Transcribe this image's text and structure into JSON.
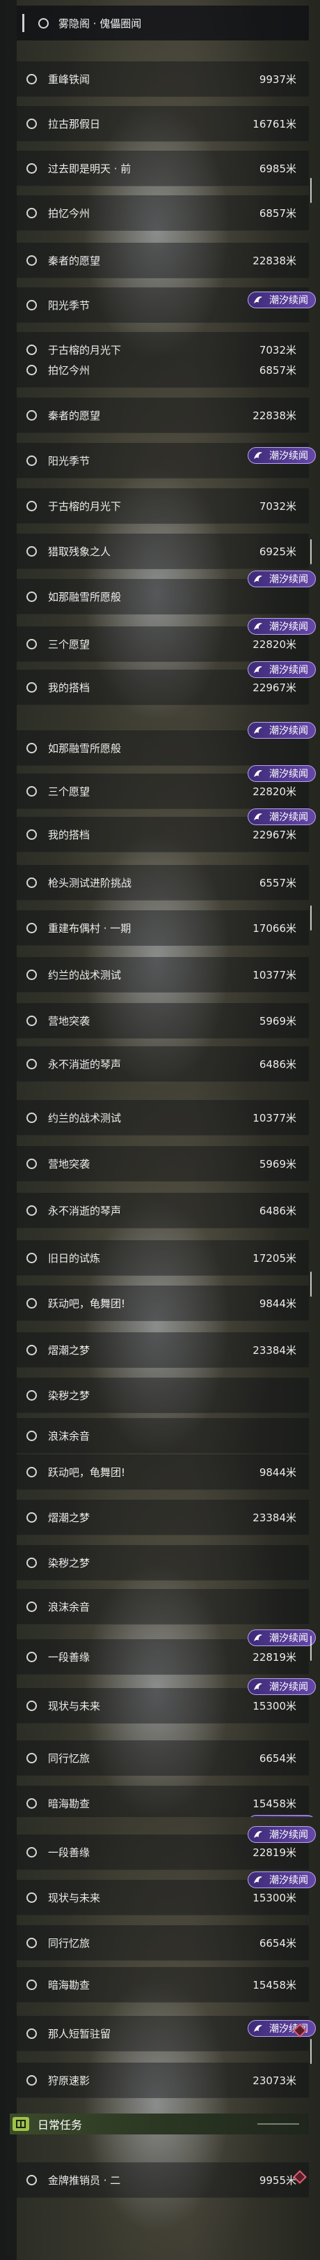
{
  "badge_label": "潮汐续闻",
  "header_title": "雾隐阁 · 傀儡圈闻",
  "daily_title": "日常任务",
  "colors": {
    "badge": "#5a3c9c",
    "accent_green": "#9ec24a",
    "alert": "#e06070"
  },
  "panels": [
    {
      "rows": [
        {
          "name": "重峰铁闻",
          "dist": "9937米"
        },
        {
          "name": "拉古那假日",
          "dist": "16761米"
        },
        {
          "name": "过去即是明天 · 前",
          "dist": "6985米"
        },
        {
          "name": "拍忆今州",
          "dist": "6857米"
        },
        {
          "name": "秦者的愿望",
          "dist": "22838米"
        },
        {
          "name": "阳光季节",
          "dist": ""
        },
        {
          "name": "于古榕的月光下",
          "dist": "7032米"
        }
      ]
    },
    {
      "rows": [
        {
          "name": "拍忆今州",
          "dist": "6857米"
        },
        {
          "name": "秦者的愿望",
          "dist": "22838米"
        },
        {
          "name": "阳光季节",
          "dist": ""
        },
        {
          "name": "于古榕的月光下",
          "dist": "7032米"
        },
        {
          "name": "猎取残象之人",
          "dist": "6925米"
        },
        {
          "name": "如那融雪所愿般",
          "dist": ""
        },
        {
          "name": "三个愿望",
          "dist": "22820米"
        },
        {
          "name": "我的搭档",
          "dist": "22967米"
        }
      ]
    },
    {
      "rows": [
        {
          "name": "如那融雪所愿般",
          "dist": ""
        },
        {
          "name": "三个愿望",
          "dist": "22820米"
        },
        {
          "name": "我的搭档",
          "dist": "22967米"
        },
        {
          "name": "枪头测试进阶挑战",
          "dist": "6557米"
        },
        {
          "name": "重建布偶村 · 一期",
          "dist": "17066米"
        },
        {
          "name": "约兰的战术测试",
          "dist": "10377米"
        },
        {
          "name": "营地突袭",
          "dist": "5969米"
        },
        {
          "name": "永不消逝的琴声",
          "dist": "6486米"
        }
      ]
    },
    {
      "rows": [
        {
          "name": "约兰的战术测试",
          "dist": "10377米"
        },
        {
          "name": "营地突袭",
          "dist": "5969米"
        },
        {
          "name": "永不消逝的琴声",
          "dist": "6486米"
        },
        {
          "name": "旧日的试炼",
          "dist": "17205米"
        },
        {
          "name": "跃动吧，龟舞团!",
          "dist": "9844米"
        },
        {
          "name": "熠潮之梦",
          "dist": "23384米"
        },
        {
          "name": "染秽之梦",
          "dist": ""
        },
        {
          "name": "浪沫余音",
          "dist": ""
        }
      ]
    },
    {
      "rows": [
        {
          "name": "跃动吧，龟舞团!",
          "dist": "9844米"
        },
        {
          "name": "熠潮之梦",
          "dist": "23384米"
        },
        {
          "name": "染秽之梦",
          "dist": ""
        },
        {
          "name": "浪沫余音",
          "dist": ""
        },
        {
          "name": "一段善缘",
          "dist": "22819米"
        },
        {
          "name": "现状与未来",
          "dist": "15300米"
        },
        {
          "name": "同行忆旅",
          "dist": "6654米"
        },
        {
          "name": "暗海勘查",
          "dist": "15458米"
        }
      ]
    },
    {
      "rows": [
        {
          "name": "一段善缘",
          "dist": "22819米"
        },
        {
          "name": "现状与未来",
          "dist": "15300米"
        },
        {
          "name": "同行忆旅",
          "dist": "6654米"
        },
        {
          "name": "暗海勘查",
          "dist": "15458米"
        },
        {
          "name": "那人短暂驻留",
          "dist": ""
        },
        {
          "name": "狩原速影",
          "dist": "23073米"
        },
        {
          "name": "金牌推销员 · 二",
          "dist": "9955米"
        }
      ]
    }
  ]
}
